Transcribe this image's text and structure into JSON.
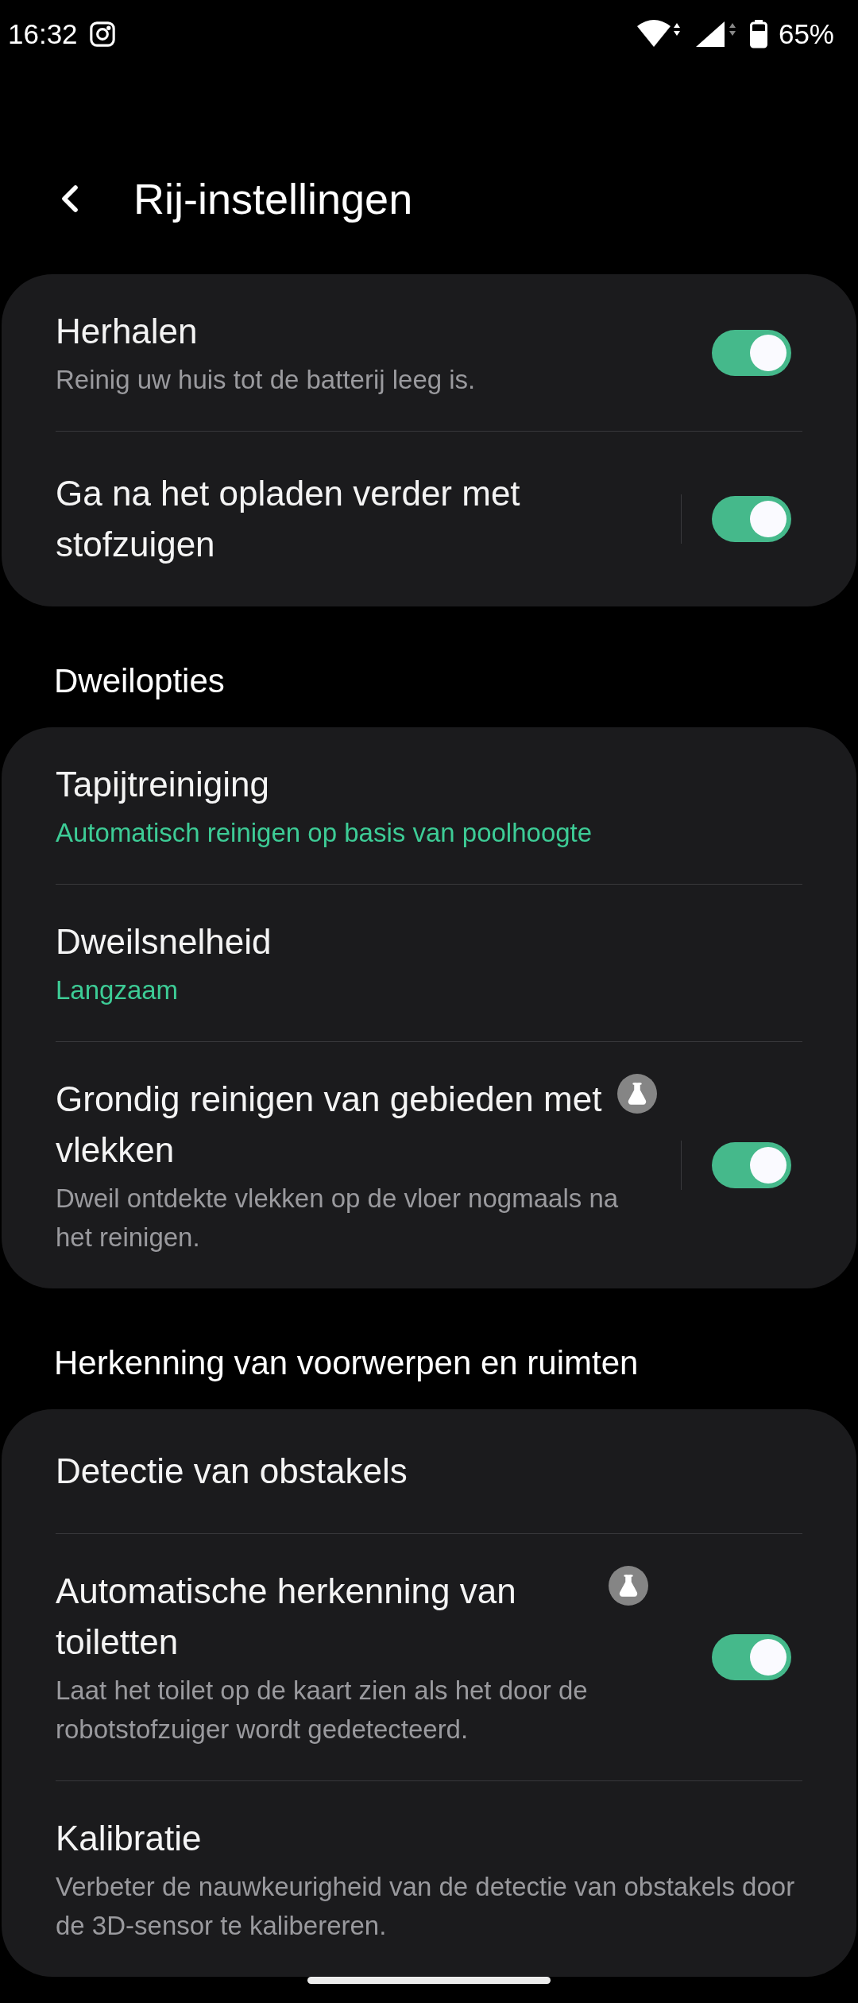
{
  "status_bar": {
    "time": "16:32",
    "battery": "65%"
  },
  "header": {
    "title": "Rij-instellingen"
  },
  "sections": [
    {
      "items": [
        {
          "kind": "toggle",
          "title": "Herhalen",
          "description": "Reinig uw huis tot de batterij leeg is.",
          "on": true,
          "labs": false
        },
        {
          "kind": "split-toggle",
          "title": "Ga na het opladen verder met stofzuigen",
          "on": true,
          "labs": false
        }
      ]
    },
    {
      "heading": "Dweilopties",
      "items": [
        {
          "kind": "link",
          "title": "Tapijtreiniging",
          "value": "Automatisch reinigen op basis van poolhoogte",
          "labs": false
        },
        {
          "kind": "link",
          "title": "Dweilsnelheid",
          "value": "Langzaam",
          "labs": false
        },
        {
          "kind": "split-toggle",
          "title": "Grondig reinigen van gebieden met vlekken",
          "description": "Dweil ontdekte vlekken op de vloer nogmaals na het reinigen.",
          "on": true,
          "labs": true
        }
      ]
    },
    {
      "heading": "Herkenning van voorwerpen en ruimten",
      "items": [
        {
          "kind": "link",
          "title": "Detectie van obstakels",
          "labs": false
        },
        {
          "kind": "toggle",
          "title": "Automatische herkenning van toiletten",
          "description": "Laat het toilet op de kaart zien als het door de robotstofzuiger wordt gedetecteerd.",
          "on": true,
          "labs": true
        },
        {
          "kind": "link",
          "title": "Kalibratie",
          "description": "Verbeter de nauwkeurigheid van de detectie van obstakels door de 3D-sensor te kalibereren.",
          "labs": false
        }
      ]
    }
  ]
}
